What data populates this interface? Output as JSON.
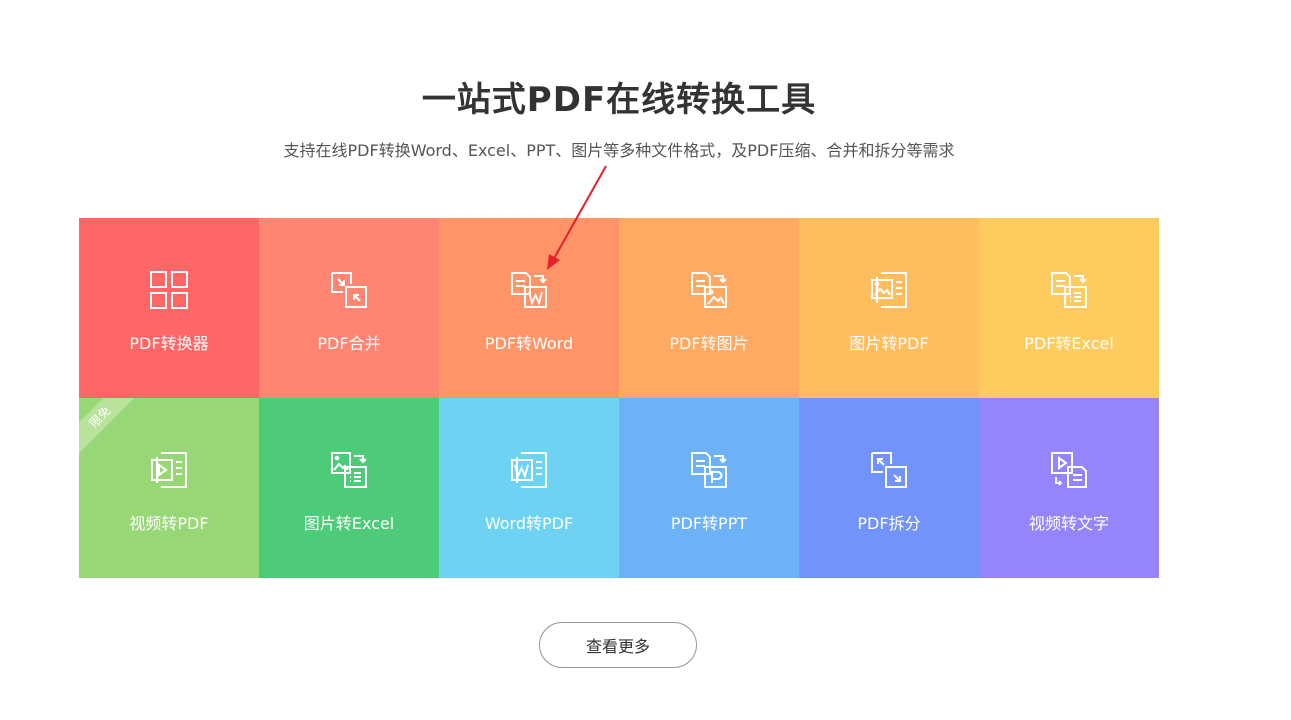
{
  "header": {
    "title": "一站式PDF在线转换工具",
    "subtitle": "支持在线PDF转换Word、Excel、PPT、图片等多种文件格式，及PDF压缩、合并和拆分等需求"
  },
  "tools": [
    {
      "label": "PDF转换器",
      "icon": "grid-icon",
      "color": "#ff6666"
    },
    {
      "label": "PDF合并",
      "icon": "merge-icon",
      "color": "#ff8471"
    },
    {
      "label": "PDF转Word",
      "icon": "pdf-to-word-icon",
      "color": "#ff9468"
    },
    {
      "label": "PDF转图片",
      "icon": "pdf-to-image-icon",
      "color": "#ffa963"
    },
    {
      "label": "图片转PDF",
      "icon": "image-to-pdf-icon",
      "color": "#ffbd5e"
    },
    {
      "label": "PDF转Excel",
      "icon": "pdf-to-excel-icon",
      "color": "#ffcb5e"
    },
    {
      "label": "视频转PDF",
      "icon": "video-to-pdf-icon",
      "color": "#98d776",
      "badge": "限免"
    },
    {
      "label": "图片转Excel",
      "icon": "image-to-excel-icon",
      "color": "#4ecb79"
    },
    {
      "label": "Word转PDF",
      "icon": "word-to-pdf-icon",
      "color": "#6ed3f3"
    },
    {
      "label": "PDF转PPT",
      "icon": "pdf-to-ppt-icon",
      "color": "#6db2f6"
    },
    {
      "label": "PDF拆分",
      "icon": "split-icon",
      "color": "#7193fb"
    },
    {
      "label": "视频转文字",
      "icon": "video-to-text-icon",
      "color": "#9585fc"
    }
  ],
  "more_button": {
    "label": "查看更多"
  },
  "annotation": {
    "arrow_color": "#e8202a"
  }
}
